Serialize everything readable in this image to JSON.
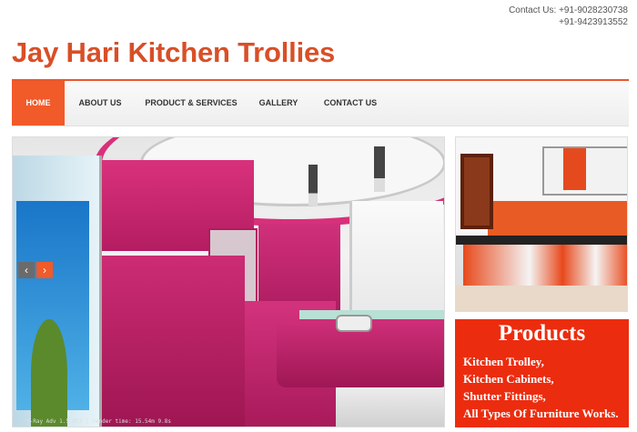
{
  "contact": {
    "line1": "Contact Us: +91-9028230738",
    "line2": "+91-9423913552"
  },
  "site": {
    "title": "Jay Hari Kitchen Trollies",
    "accent_color": "#f15a29",
    "title_color": "#d94f27"
  },
  "nav": {
    "items": [
      {
        "label": "HOME",
        "active": true
      },
      {
        "label": "ABOUT US",
        "active": false
      },
      {
        "label": "PRODUCT & SERVICES",
        "active": false
      },
      {
        "label": "GALLERY",
        "active": false
      },
      {
        "label": "CONTACT US",
        "active": false
      }
    ]
  },
  "slider": {
    "prev_icon": "‹",
    "next_icon": "›",
    "image_caption": "V-Ray Adv 1.5 RC3 | render time: 15.54m 9.8s"
  },
  "products": {
    "title": "Products",
    "items": [
      "Kitchen Trolley,",
      "Kitchen Cabinets,",
      "Shutter Fittings,",
      "All Types Of Furniture Works."
    ],
    "background_color": "#ec2c0e"
  }
}
